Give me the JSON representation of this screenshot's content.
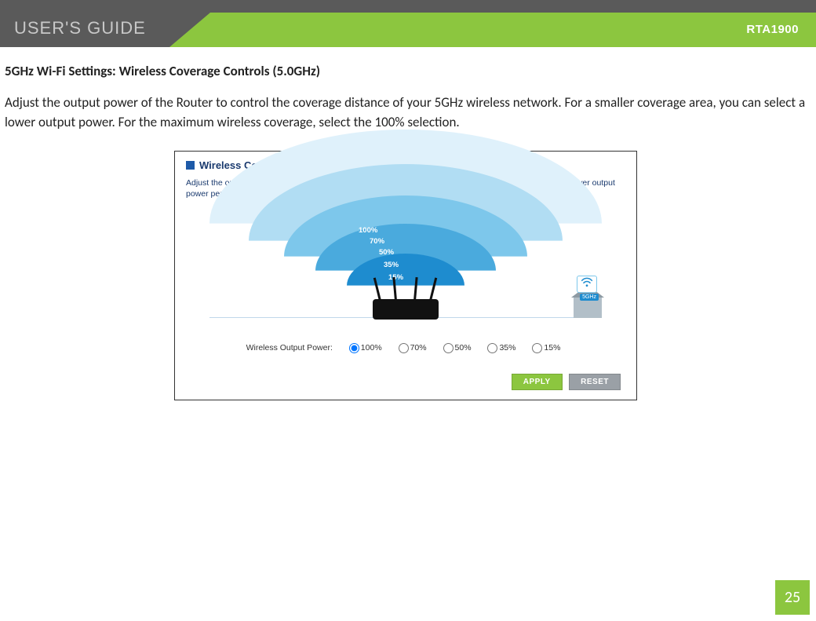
{
  "header": {
    "title": "USER'S GUIDE",
    "model": "RTA1900"
  },
  "section": {
    "title": "5GHz Wi-Fi Settings: Wireless Coverage Controls (5.0GHz)",
    "body": "Adjust the output power of the Router to control the coverage distance of your 5GHz wireless network.  For a smaller coverage area, you can select a lower output power. For the maximum wireless coverage, select the 100% selection."
  },
  "panel": {
    "heading": "Wireless Coverage Controls (5.0GHz)",
    "desc": "Adjust the output power and range of your 5.0GHz Wi-Fi network. For a smaller coverage area, choose a lower output power percentage. For a larger coverage area, select a higher output power percentage.",
    "percent_labels": {
      "p100": "100%",
      "p70": "70%",
      "p50": "50%",
      "p35": "35%",
      "p15": "15%"
    },
    "wifi_badge": "5GHz",
    "radio_label": "Wireless Output Power:",
    "options": [
      "100%",
      "70%",
      "50%",
      "35%",
      "15%"
    ],
    "selected": "100%",
    "apply": "APPLY",
    "reset": "RESET"
  },
  "page_number": "25"
}
